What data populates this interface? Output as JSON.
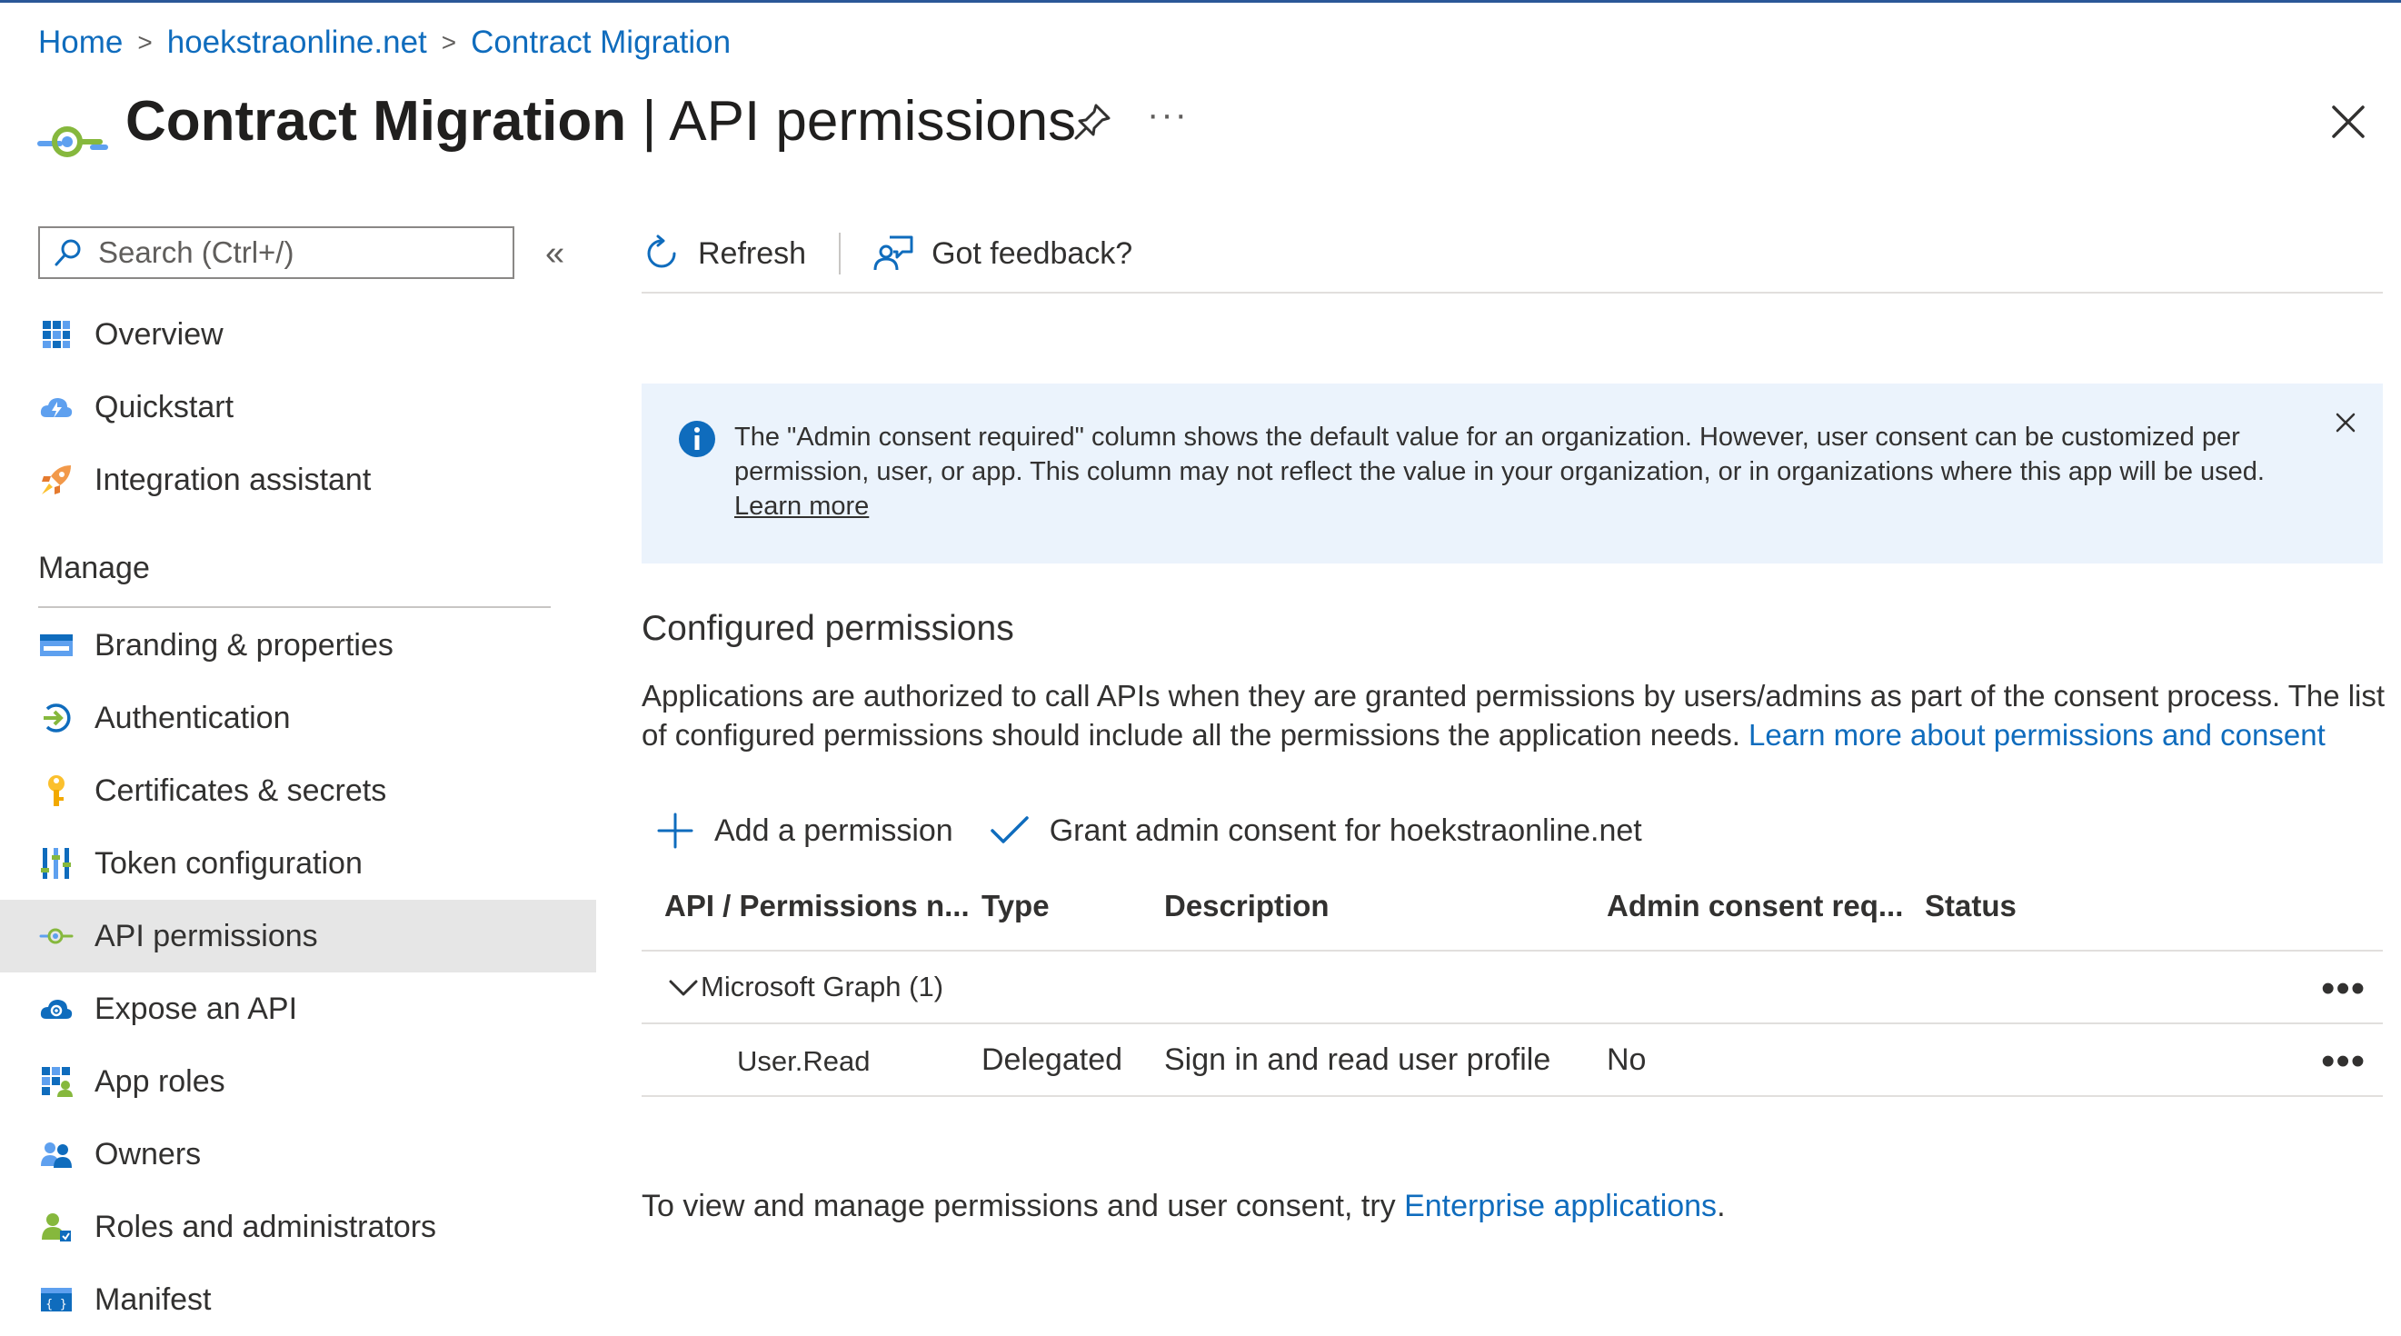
{
  "breadcrumb": {
    "home": "Home",
    "tenant": "hoekstraonline.net",
    "current": "Contract Migration"
  },
  "header": {
    "title_app": "Contract Migration",
    "title_sep": " | ",
    "title_page": "API permissions",
    "more": "···"
  },
  "sidebar": {
    "search_placeholder": "Search (Ctrl+/)",
    "collapse": "«",
    "items_top": [
      {
        "label": "Overview",
        "icon": "overview-grid-icon"
      },
      {
        "label": "Quickstart",
        "icon": "quickstart-cloud-icon"
      },
      {
        "label": "Integration assistant",
        "icon": "rocket-icon"
      }
    ],
    "section_manage": "Manage",
    "items_manage": [
      {
        "label": "Branding & properties",
        "icon": "branding-icon"
      },
      {
        "label": "Authentication",
        "icon": "authentication-icon"
      },
      {
        "label": "Certificates & secrets",
        "icon": "key-icon"
      },
      {
        "label": "Token configuration",
        "icon": "token-bars-icon"
      },
      {
        "label": "API permissions",
        "icon": "api-permissions-icon",
        "active": true
      },
      {
        "label": "Expose an API",
        "icon": "expose-cloud-icon"
      },
      {
        "label": "App roles",
        "icon": "app-roles-grid-icon"
      },
      {
        "label": "Owners",
        "icon": "owners-people-icon"
      },
      {
        "label": "Roles and administrators",
        "icon": "roles-admin-icon"
      },
      {
        "label": "Manifest",
        "icon": "manifest-icon"
      }
    ]
  },
  "toolbar": {
    "refresh": "Refresh",
    "feedback": "Got feedback?"
  },
  "banner": {
    "text": "The \"Admin consent required\" column shows the default value for an organization. However, user consent can be customized per permission, user, or app. This column may not reflect the value in your organization, or in organizations where this app will be used. ",
    "link": "Learn more"
  },
  "configured": {
    "title": "Configured permissions",
    "desc": "Applications are authorized to call APIs when they are granted permissions by users/admins as part of the consent process. The list of configured permissions should include all the permissions the application needs. ",
    "desc_link": "Learn more about permissions and consent",
    "add_permission": "Add a permission",
    "grant_consent": "Grant admin consent for hoekstraonline.net"
  },
  "table": {
    "headers": [
      "API / Permissions n...",
      "Type",
      "Description",
      "Admin consent req...",
      "Status"
    ],
    "group": "Microsoft Graph (1)",
    "rows": [
      {
        "name": "User.Read",
        "type": "Delegated",
        "description": "Sign in and read user profile",
        "admin_consent": "No",
        "status": ""
      }
    ],
    "more": "•••"
  },
  "footer": {
    "text": "To view and manage permissions and user consent, try ",
    "link": "Enterprise applications",
    "end": "."
  },
  "colors": {
    "accent": "#0f6cbd",
    "banner_bg": "#ebf3fc",
    "active_nav": "#e6e6e6"
  }
}
